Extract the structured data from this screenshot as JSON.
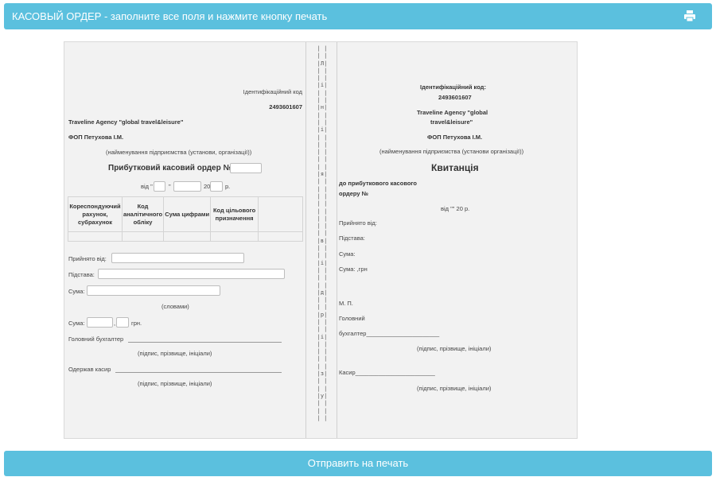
{
  "header": {
    "title": "КАСОВЫЙ ОРДЕР - заполните все поля и нажмите кнопку печать",
    "print_icon": "printer-icon"
  },
  "left": {
    "id_code_label": "Ідентифікаційний код",
    "id_code_value": "2493601607",
    "agency": "Traveline Agency \"global travel&leisure\"",
    "fop": "ФОП Петухова І.М.",
    "org_caption": "(найменування підприємства (установи, організації))",
    "order_title": "Прибутковий касовий ордер №",
    "date_from": "від \"",
    "date_quote": "\"",
    "date_year": "20",
    "date_suffix": "р.",
    "table_headers": [
      "Кореспондуючий рахунок, субрахунок",
      "Код аналітичного обліку",
      "Сума цифрами",
      "Код цільового призначення",
      ""
    ],
    "received_from": "Прийнято від:",
    "basis": "Підстава:",
    "sum": "Сума:",
    "in_words": "(словами)",
    "sum2": "Сума:",
    "comma": ",",
    "uah": "грн.",
    "chief_accountant": "Головний бухгалтер",
    "signature_caption1": "(підпис, прізвище, ініціали)",
    "cashier_received": "Одержав касир",
    "signature_caption2": "(підпис, прізвище, ініціали)"
  },
  "separator": {
    "letters": [
      "| |",
      "| |",
      "|Л|",
      "| |",
      "| |",
      "|і|",
      "| |",
      "| |",
      "|н|",
      "| |",
      "| |",
      "|і|",
      "| |",
      "| |",
      "| |",
      "| |",
      "| |",
      "|я|",
      "| |",
      "| |",
      "| |",
      "| |",
      "| |",
      "| |",
      "| |",
      "| |",
      "|в|",
      "| |",
      "| |",
      "|і|",
      "| |",
      "| |",
      "| |",
      "|д|",
      "| |",
      "| |",
      "|р|",
      "| |",
      "| |",
      "|і|",
      "| |",
      "| |",
      "| |",
      "| |",
      "|з|",
      "| |",
      "| |",
      "|у|",
      "| |",
      "| |",
      "| |"
    ]
  },
  "right": {
    "id_code_label": "Ідентифікаційний код:",
    "id_code_value": "2493601607",
    "agency_line1": "Traveline Agency \"global",
    "agency_line2": "travel&leisure\"",
    "fop": "ФОП Петухова І.М.",
    "org_caption": "(найменування підприємства (установи організації))",
    "receipt_title": "Квитанція",
    "to_order_line1": "до прибуткового касового",
    "to_order_line2": "ордеру №",
    "date_line": "від \"\" 20 р.",
    "received_from": "Прийнято від:",
    "basis": "Підстава:",
    "sum": "Сума:",
    "sum_uah": "Сума: ,грн",
    "mp": "М. П.",
    "chief": "Головний",
    "accountant": "бухгалтер______________________",
    "signature_caption1": "(підпис, прізвище, ініціали)",
    "cashier": "Касир________________________",
    "signature_caption2": "(підпис, прізвище, ініціали)"
  },
  "footer": {
    "send_button": "Отправить на печать"
  },
  "colors": {
    "accent": "#5bc0de"
  }
}
